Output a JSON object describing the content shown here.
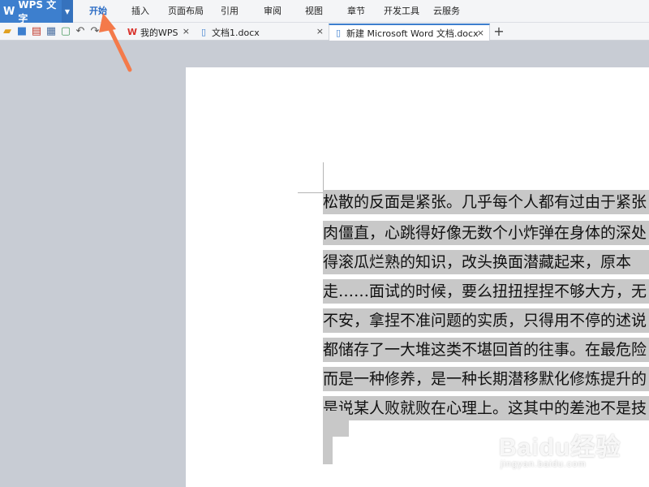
{
  "app": {
    "logo": "WPS 文字"
  },
  "ribbon_tabs": [
    {
      "label": "开始",
      "active": true
    },
    {
      "label": "插入"
    },
    {
      "label": "页面布局"
    },
    {
      "label": "引用"
    },
    {
      "label": "审阅"
    },
    {
      "label": "视图"
    },
    {
      "label": "章节"
    },
    {
      "label": "开发工具"
    },
    {
      "label": "云服务"
    }
  ],
  "toolbar_icons": [
    "open-folder-icon",
    "save-icon",
    "export-pdf-icon",
    "print-icon",
    "print-preview-icon",
    "undo-icon",
    "redo-icon"
  ],
  "doc_tabs": [
    {
      "label": "我的WPS",
      "close": "×",
      "icon": "wps-icon"
    },
    {
      "label": "文档1.docx",
      "close": "×",
      "icon": "document-icon"
    },
    {
      "label": "新建 Microsoft Word 文档.docx",
      "close": "×",
      "icon": "document-icon",
      "active": true
    }
  ],
  "add_tab": "+",
  "document": {
    "lines": [
      "松散的反面是紧张。几乎每个人都有过由于紧张",
      "肉僵直，心跳得好像无数个小炸弹在身体的深处",
      "得滚瓜烂熟的知识，改头换面潜藏起来，原本",
      "走……面试的时候，要么扭扭捏捏不够大方，无",
      "不安，拿捏不准问题的实质，只得用不停的述说",
      "都储存了一大堆这类不堪回首的往事。在最危险",
      "而是一种修养，是一种长期潜移默化修炼提升的",
      "是说某人败就败在心理上。这其中的差池不是技"
    ]
  },
  "colors": {
    "accent": "#3d7fce",
    "selection": "#c8c8c8",
    "annotation_arrow": "#f47a4a",
    "workspace": "#c8ccd4"
  },
  "watermark": {
    "brand": "Baidu经验",
    "site": "jingyan.baidu.com"
  }
}
